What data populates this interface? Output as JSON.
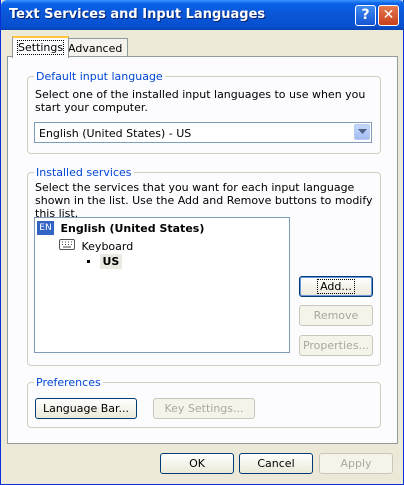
{
  "window": {
    "title": "Text Services and Input Languages",
    "help_glyph": "?",
    "close_glyph": "✕"
  },
  "tabs": [
    {
      "label": "Settings"
    },
    {
      "label": "Advanced"
    }
  ],
  "default_language": {
    "legend": "Default input language",
    "description": "Select one of the installed input languages to use when you start your computer.",
    "selected": "English (United States) - US"
  },
  "installed_services": {
    "legend": "Installed services",
    "description": "Select the services that you want for each input language shown in the list. Use the Add and Remove buttons to modify this list.",
    "tree": {
      "language_badge": "EN",
      "language": "English (United States)",
      "category": "Keyboard",
      "layout": "US"
    },
    "buttons": {
      "add": "Add...",
      "remove": "Remove",
      "properties": "Properties..."
    }
  },
  "preferences": {
    "legend": "Preferences",
    "language_bar": "Language Bar...",
    "key_settings": "Key Settings..."
  },
  "footer": {
    "ok": "OK",
    "cancel": "Cancel",
    "apply": "Apply"
  },
  "colors": {
    "title_bar": "#0a56d7",
    "group_legend": "#0046d5",
    "badge": "#3163c5"
  },
  "icons": {
    "language": "language-badge-icon",
    "keyboard": "keyboard-icon",
    "dropdown": "chevron-down-icon"
  }
}
